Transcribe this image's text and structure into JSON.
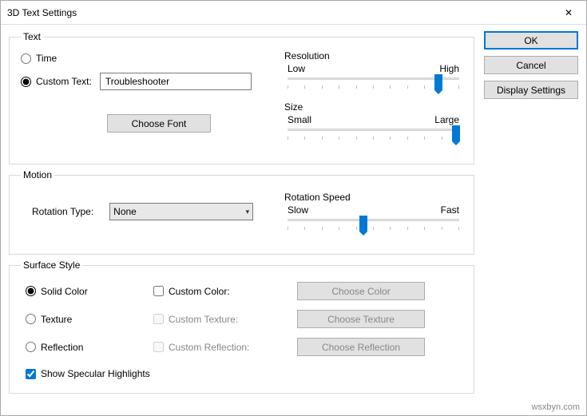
{
  "window": {
    "title": "3D Text Settings",
    "close": "✕"
  },
  "buttons": {
    "ok": "OK",
    "cancel": "Cancel",
    "display_settings": "Display Settings"
  },
  "text": {
    "legend": "Text",
    "time": "Time",
    "custom_label": "Custom Text:",
    "custom_value": "Troubleshooter",
    "choose_font": "Choose Font",
    "resolution": {
      "label": "Resolution",
      "low": "Low",
      "high": "High",
      "value_pct": 88
    },
    "size": {
      "label": "Size",
      "small": "Small",
      "large": "Large",
      "value_pct": 98
    }
  },
  "motion": {
    "legend": "Motion",
    "rotation_type_label": "Rotation Type:",
    "rotation_type_value": "None",
    "rotation_speed": {
      "label": "Rotation Speed",
      "slow": "Slow",
      "fast": "Fast",
      "value_pct": 44
    }
  },
  "surface": {
    "legend": "Surface Style",
    "solid": "Solid Color",
    "texture": "Texture",
    "reflection": "Reflection",
    "custom_color": "Custom Color:",
    "custom_texture": "Custom Texture:",
    "custom_reflection": "Custom Reflection:",
    "choose_color": "Choose Color",
    "choose_texture": "Choose Texture",
    "choose_reflection": "Choose Reflection",
    "specular": "Show Specular Highlights"
  },
  "watermark": "wsxbyn.com"
}
